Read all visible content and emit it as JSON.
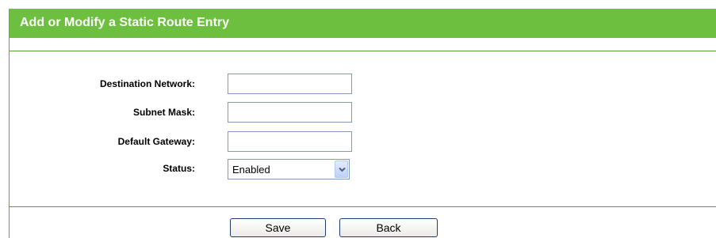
{
  "title": "Add or Modify a Static Route Entry",
  "form": {
    "destination_network": {
      "label": "Destination Network:",
      "value": ""
    },
    "subnet_mask": {
      "label": "Subnet Mask:",
      "value": ""
    },
    "default_gateway": {
      "label": "Default Gateway:",
      "value": ""
    },
    "status": {
      "label": "Status:",
      "selected": "Enabled"
    }
  },
  "buttons": {
    "save": "Save",
    "back": "Back"
  },
  "colors": {
    "title_bar": "#6cbf3f",
    "title_text": "#ffffff",
    "separator": "#55a232"
  }
}
